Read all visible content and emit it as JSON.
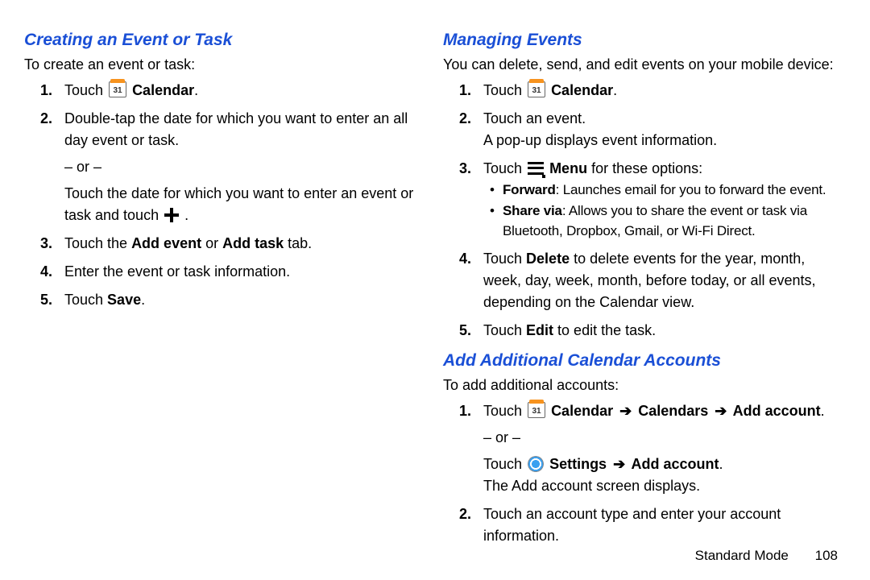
{
  "left": {
    "heading": "Creating an Event or Task",
    "intro": "To create an event or task:",
    "touch_prefix": "Touch ",
    "calendar_label": " Calendar",
    "step2": "Double-tap the date for which you want to enter an all day event or task.",
    "or": "– or –",
    "step2b_a": "Touch the date for which you want to enter an event or task and touch ",
    "step2b_end": " .",
    "step3_a": "Touch the ",
    "step3_b": "Add event",
    "step3_c": " or ",
    "step3_d": "Add task",
    "step3_e": " tab.",
    "step4": "Enter the event or task information.",
    "step5_a": "Touch ",
    "step5_b": "Save",
    "step5_c": "."
  },
  "right": {
    "heading1": "Managing Events",
    "intro1": "You can delete, send, and edit events on your mobile device:",
    "touch_prefix": "Touch ",
    "calendar_label": " Calendar",
    "step2": "Touch an event.",
    "step2b": "A pop-up displays event information.",
    "step3_a": "Touch ",
    "step3_b": " Menu",
    "step3_c": " for these options:",
    "sub1_label": "Forward",
    "sub1_rest": ": Launches email for you to forward the event.",
    "sub2_label": "Share via",
    "sub2_rest": ": Allows you to share the event or task via Bluetooth, Dropbox, Gmail, or Wi-Fi Direct.",
    "step4_a": "Touch ",
    "step4_b": "Delete",
    "step4_c": " to delete events for the year, month, week, day, week, month, before today, or all events, depending on the Calendar view.",
    "step5_a": "Touch ",
    "step5_b": "Edit",
    "step5_c": " to edit the task.",
    "heading2": "Add Additional Calendar Accounts",
    "intro2": "To add additional accounts:",
    "acc1_a": "Touch ",
    "acc1_b": " Calendar ",
    "acc1_c": " Calendars ",
    "acc1_d": " Add account",
    "acc1_e": ".",
    "or": "– or –",
    "acc1alt_a": "Touch ",
    "acc1alt_b": " Settings ",
    "acc1alt_c": " Add account",
    "acc1alt_d": ".",
    "acc1alt_after": "The Add account screen displays.",
    "acc2": "Touch an account type and enter your account information."
  },
  "arrow": "➔",
  "footer": {
    "mode": "Standard Mode",
    "page": "108"
  }
}
